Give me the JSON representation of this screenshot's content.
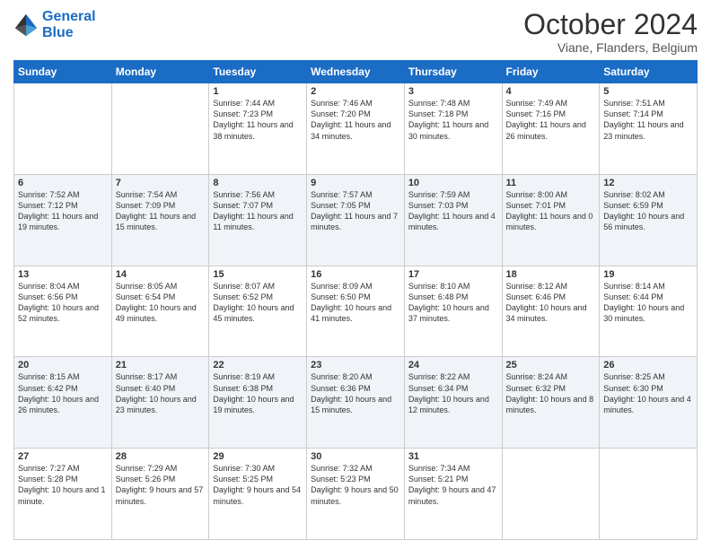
{
  "logo": {
    "line1": "General",
    "line2": "Blue"
  },
  "header": {
    "title": "October 2024",
    "subtitle": "Viane, Flanders, Belgium"
  },
  "days_of_week": [
    "Sunday",
    "Monday",
    "Tuesday",
    "Wednesday",
    "Thursday",
    "Friday",
    "Saturday"
  ],
  "weeks": [
    [
      {
        "day": "",
        "info": ""
      },
      {
        "day": "",
        "info": ""
      },
      {
        "day": "1",
        "info": "Sunrise: 7:44 AM\nSunset: 7:23 PM\nDaylight: 11 hours and 38 minutes."
      },
      {
        "day": "2",
        "info": "Sunrise: 7:46 AM\nSunset: 7:20 PM\nDaylight: 11 hours and 34 minutes."
      },
      {
        "day": "3",
        "info": "Sunrise: 7:48 AM\nSunset: 7:18 PM\nDaylight: 11 hours and 30 minutes."
      },
      {
        "day": "4",
        "info": "Sunrise: 7:49 AM\nSunset: 7:16 PM\nDaylight: 11 hours and 26 minutes."
      },
      {
        "day": "5",
        "info": "Sunrise: 7:51 AM\nSunset: 7:14 PM\nDaylight: 11 hours and 23 minutes."
      }
    ],
    [
      {
        "day": "6",
        "info": "Sunrise: 7:52 AM\nSunset: 7:12 PM\nDaylight: 11 hours and 19 minutes."
      },
      {
        "day": "7",
        "info": "Sunrise: 7:54 AM\nSunset: 7:09 PM\nDaylight: 11 hours and 15 minutes."
      },
      {
        "day": "8",
        "info": "Sunrise: 7:56 AM\nSunset: 7:07 PM\nDaylight: 11 hours and 11 minutes."
      },
      {
        "day": "9",
        "info": "Sunrise: 7:57 AM\nSunset: 7:05 PM\nDaylight: 11 hours and 7 minutes."
      },
      {
        "day": "10",
        "info": "Sunrise: 7:59 AM\nSunset: 7:03 PM\nDaylight: 11 hours and 4 minutes."
      },
      {
        "day": "11",
        "info": "Sunrise: 8:00 AM\nSunset: 7:01 PM\nDaylight: 11 hours and 0 minutes."
      },
      {
        "day": "12",
        "info": "Sunrise: 8:02 AM\nSunset: 6:59 PM\nDaylight: 10 hours and 56 minutes."
      }
    ],
    [
      {
        "day": "13",
        "info": "Sunrise: 8:04 AM\nSunset: 6:56 PM\nDaylight: 10 hours and 52 minutes."
      },
      {
        "day": "14",
        "info": "Sunrise: 8:05 AM\nSunset: 6:54 PM\nDaylight: 10 hours and 49 minutes."
      },
      {
        "day": "15",
        "info": "Sunrise: 8:07 AM\nSunset: 6:52 PM\nDaylight: 10 hours and 45 minutes."
      },
      {
        "day": "16",
        "info": "Sunrise: 8:09 AM\nSunset: 6:50 PM\nDaylight: 10 hours and 41 minutes."
      },
      {
        "day": "17",
        "info": "Sunrise: 8:10 AM\nSunset: 6:48 PM\nDaylight: 10 hours and 37 minutes."
      },
      {
        "day": "18",
        "info": "Sunrise: 8:12 AM\nSunset: 6:46 PM\nDaylight: 10 hours and 34 minutes."
      },
      {
        "day": "19",
        "info": "Sunrise: 8:14 AM\nSunset: 6:44 PM\nDaylight: 10 hours and 30 minutes."
      }
    ],
    [
      {
        "day": "20",
        "info": "Sunrise: 8:15 AM\nSunset: 6:42 PM\nDaylight: 10 hours and 26 minutes."
      },
      {
        "day": "21",
        "info": "Sunrise: 8:17 AM\nSunset: 6:40 PM\nDaylight: 10 hours and 23 minutes."
      },
      {
        "day": "22",
        "info": "Sunrise: 8:19 AM\nSunset: 6:38 PM\nDaylight: 10 hours and 19 minutes."
      },
      {
        "day": "23",
        "info": "Sunrise: 8:20 AM\nSunset: 6:36 PM\nDaylight: 10 hours and 15 minutes."
      },
      {
        "day": "24",
        "info": "Sunrise: 8:22 AM\nSunset: 6:34 PM\nDaylight: 10 hours and 12 minutes."
      },
      {
        "day": "25",
        "info": "Sunrise: 8:24 AM\nSunset: 6:32 PM\nDaylight: 10 hours and 8 minutes."
      },
      {
        "day": "26",
        "info": "Sunrise: 8:25 AM\nSunset: 6:30 PM\nDaylight: 10 hours and 4 minutes."
      }
    ],
    [
      {
        "day": "27",
        "info": "Sunrise: 7:27 AM\nSunset: 5:28 PM\nDaylight: 10 hours and 1 minute."
      },
      {
        "day": "28",
        "info": "Sunrise: 7:29 AM\nSunset: 5:26 PM\nDaylight: 9 hours and 57 minutes."
      },
      {
        "day": "29",
        "info": "Sunrise: 7:30 AM\nSunset: 5:25 PM\nDaylight: 9 hours and 54 minutes."
      },
      {
        "day": "30",
        "info": "Sunrise: 7:32 AM\nSunset: 5:23 PM\nDaylight: 9 hours and 50 minutes."
      },
      {
        "day": "31",
        "info": "Sunrise: 7:34 AM\nSunset: 5:21 PM\nDaylight: 9 hours and 47 minutes."
      },
      {
        "day": "",
        "info": ""
      },
      {
        "day": "",
        "info": ""
      }
    ]
  ]
}
